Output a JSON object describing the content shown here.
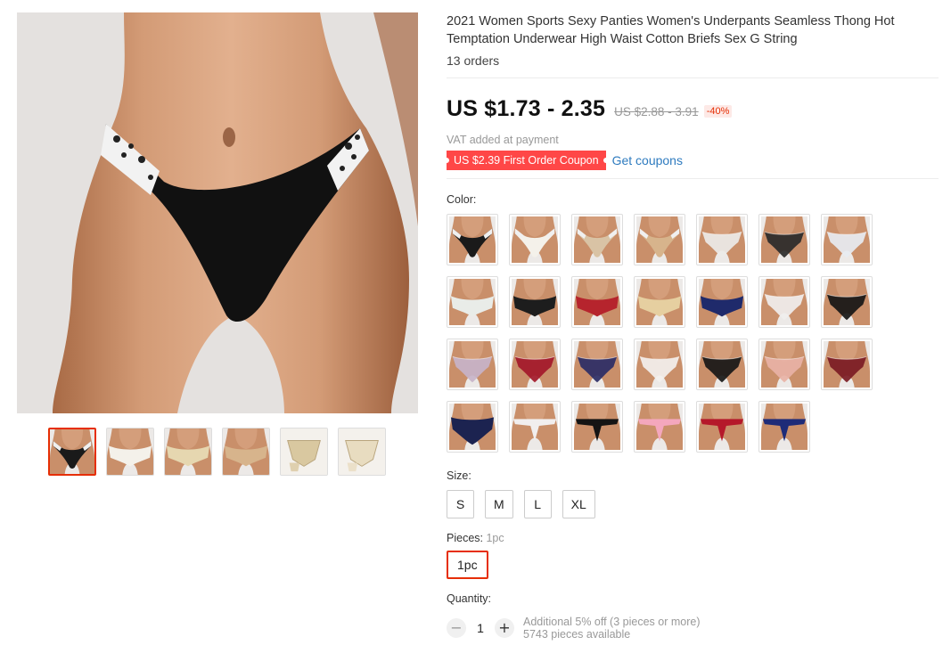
{
  "product": {
    "title": "2021 Women Sports Sexy Panties Women's Underpants Seamless Thong Hot Temptation Underwear High Waist Cotton Briefs Sex G String",
    "orders": "13 orders"
  },
  "pricing": {
    "price": "US $1.73 - 2.35",
    "original_price": "US $2.88 - 3.91",
    "discount": "-40%",
    "vat_note": "VAT added at payment",
    "coupon_label": "US $2.39 First Order Coupon",
    "get_coupons": "Get coupons"
  },
  "color": {
    "label": "Color:",
    "swatches": [
      {
        "panty": "#1a1a1a",
        "style": "band"
      },
      {
        "panty": "#f4f1ea",
        "style": "band"
      },
      {
        "panty": "#d9c3a5",
        "style": "band"
      },
      {
        "panty": "#d7b48c",
        "style": "band"
      },
      {
        "panty": "#eceae8",
        "style": "lace"
      },
      {
        "panty": "#2a2a2a",
        "style": "lace"
      },
      {
        "panty": "#e7ebf2",
        "style": "lace"
      },
      {
        "panty": "#e9ece8",
        "style": "back"
      },
      {
        "panty": "#1d1d1d",
        "style": "back"
      },
      {
        "panty": "#b6242d",
        "style": "back"
      },
      {
        "panty": "#e6cfa0",
        "style": "back"
      },
      {
        "panty": "#1f2a6b",
        "style": "back"
      },
      {
        "panty": "#f0eeee",
        "style": "lace"
      },
      {
        "panty": "#161616",
        "style": "lace"
      },
      {
        "panty": "#c7b3c9",
        "style": "lace"
      },
      {
        "panty": "#a3182a",
        "style": "lace"
      },
      {
        "panty": "#2b2d66",
        "style": "lace"
      },
      {
        "panty": "#f3f0ee",
        "style": "lace"
      },
      {
        "panty": "#171717",
        "style": "lace"
      },
      {
        "panty": "#e8b2a6",
        "style": "lace"
      },
      {
        "panty": "#7b1b24",
        "style": "lace"
      },
      {
        "panty": "#1c2350",
        "style": "front"
      },
      {
        "panty": "#f1eeee",
        "style": "string"
      },
      {
        "panty": "#141414",
        "style": "string"
      },
      {
        "panty": "#f4a7bd",
        "style": "string"
      },
      {
        "panty": "#b5182a",
        "style": "string"
      },
      {
        "panty": "#1e2b78",
        "style": "string"
      }
    ]
  },
  "size": {
    "label": "Size:",
    "options": [
      "S",
      "M",
      "L",
      "XL"
    ]
  },
  "pieces": {
    "label": "Pieces:",
    "selected_label": "1pc",
    "option": "1pc"
  },
  "quantity": {
    "label": "Quantity:",
    "value": "1",
    "minus": "−",
    "plus": "+",
    "note": "Additional 5% off (3 pieces or more)",
    "available": "5743 pieces available"
  },
  "thumbnails": [
    {
      "panty": "#1a1a1a",
      "style": "band"
    },
    {
      "panty": "#f4f1ea",
      "style": "back"
    },
    {
      "panty": "#e6d7b0",
      "style": "back"
    },
    {
      "panty": "#d7b48c",
      "style": "back"
    },
    {
      "panty": "#d9c8a0",
      "style": "flat"
    },
    {
      "panty": "#e8dcc0",
      "style": "flat"
    }
  ],
  "colors": {
    "accent": "#e62e04",
    "coupon_bg": "#ff4747",
    "link": "#2e7bbf",
    "skin": "#c98f6a"
  }
}
